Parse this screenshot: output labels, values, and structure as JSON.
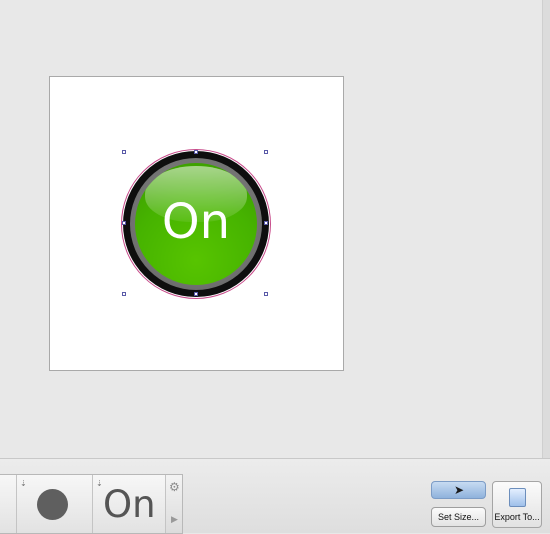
{
  "canvas": {
    "button": {
      "label": "On",
      "face_color": "#46b300",
      "ring_color": "#6f6f6f",
      "bezel_color": "#0e0e0e"
    }
  },
  "palette": {
    "items": [
      {
        "name": "circle-shape",
        "label": ""
      },
      {
        "name": "text-on",
        "label": "On"
      }
    ]
  },
  "toolbar": {
    "set_size_label": "Set Size...",
    "export_label": "Export To..."
  },
  "colors": {
    "accent": "#8fb2dc",
    "selection_handle": "#5a5aa8"
  }
}
